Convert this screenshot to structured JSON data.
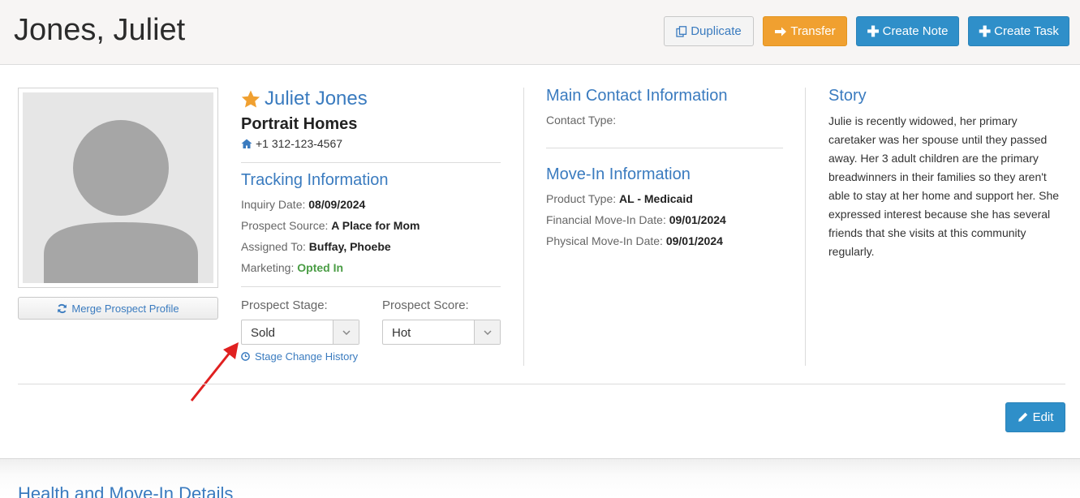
{
  "header": {
    "title": "Jones, Juliet",
    "buttons": {
      "duplicate": "Duplicate",
      "transfer": "Transfer",
      "create_note": "Create Note",
      "create_task": "Create Task"
    }
  },
  "profile": {
    "merge_label": "Merge Prospect Profile",
    "name": "Juliet Jones",
    "company": "Portrait Homes",
    "phone": "+1 312-123-4567"
  },
  "tracking": {
    "title": "Tracking Information",
    "inquiry_label": "Inquiry Date:",
    "inquiry_value": "08/09/2024",
    "source_label": "Prospect Source:",
    "source_value": "A Place for Mom",
    "assigned_label": "Assigned To:",
    "assigned_value": "Buffay, Phoebe",
    "marketing_label": "Marketing:",
    "marketing_value": "Opted In"
  },
  "stage": {
    "label": "Prospect Stage:",
    "value": "Sold",
    "history_label": "Stage Change History"
  },
  "score": {
    "label": "Prospect Score:",
    "value": "Hot"
  },
  "contact": {
    "title": "Main Contact Information",
    "type_label": "Contact Type:"
  },
  "movein": {
    "title": "Move-In Information",
    "product_label": "Product Type:",
    "product_value": "AL - Medicaid",
    "financial_label": "Financial Move-In Date:",
    "financial_value": "09/01/2024",
    "physical_label": "Physical Move-In Date:",
    "physical_value": "09/01/2024"
  },
  "story": {
    "title": "Story",
    "text": "Julie is recently widowed, her primary caretaker was her spouse until they passed away. Her 3 adult children are the primary breadwinners in their families so they aren't able to stay at her home and support her. She expressed interest because she has several friends that she visits at this community regularly."
  },
  "edit_label": "Edit",
  "health_title": "Health and Move-In Details",
  "colors": {
    "accent_blue": "#3a7bbf",
    "button_blue": "#2f8fc9",
    "button_orange": "#f0a030",
    "star": "#f0a030",
    "opted_in_green": "#4a9d45",
    "annotation_red": "#e02020"
  }
}
